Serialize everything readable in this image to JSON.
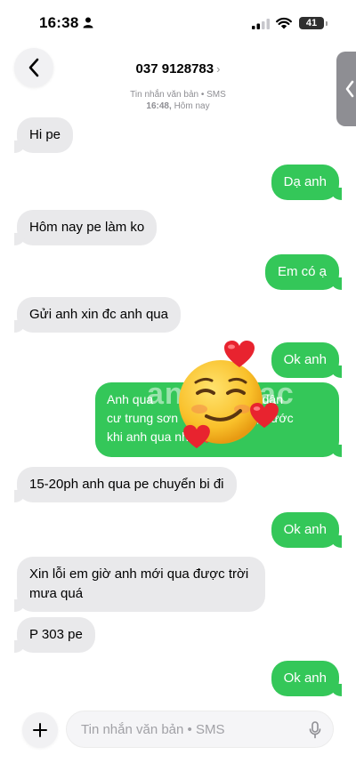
{
  "status": {
    "time": "16:38",
    "battery": "41"
  },
  "header": {
    "contact": "037 9128783",
    "service": "Tin nhắn văn bản • SMS",
    "timestamp_time": "16:48,",
    "timestamp_day": "Hôm nay"
  },
  "messages": [
    {
      "from": "in",
      "text": "Hi pe"
    },
    {
      "from": "out",
      "text": "Dạ anh"
    },
    {
      "from": "in",
      "text": "Hôm nay pe làm ko"
    },
    {
      "from": "out",
      "text": "Em có ạ"
    },
    {
      "from": "in",
      "text": "Gửi anh xin đc anh qua"
    },
    {
      "from": "out",
      "text": "Ok anh"
    },
    {
      "from": "out",
      "text": "Anh qua",
      "text2": "khu dân",
      "text3": "cư trung sơn",
      "text4": "g , trước",
      "text5": "khi anh qua nhé",
      "text6": "❤️😘"
    },
    {
      "from": "in",
      "text": "15-20ph anh qua pe chuyển bi đi"
    },
    {
      "from": "out",
      "text": "Ok anh"
    },
    {
      "from": "in",
      "text": "Xin lỗi em giờ anh mới qua được trời mưa quá"
    },
    {
      "from": "in",
      "text": "P 303 pe"
    },
    {
      "from": "out",
      "text": "Ok anh"
    }
  ],
  "watermark": "anchoi.ac",
  "compose": {
    "placeholder": "Tin nhắn văn bản • SMS"
  },
  "icons": [
    "person-icon",
    "signal-icon",
    "wifi-icon",
    "back-chevron-icon",
    "side-tab-chevron-icon",
    "plus-icon",
    "mic-icon",
    "smirk-emoji",
    "heart-emoji"
  ],
  "colors": {
    "outgoing": "#34c759",
    "incoming": "#e9e9eb"
  }
}
